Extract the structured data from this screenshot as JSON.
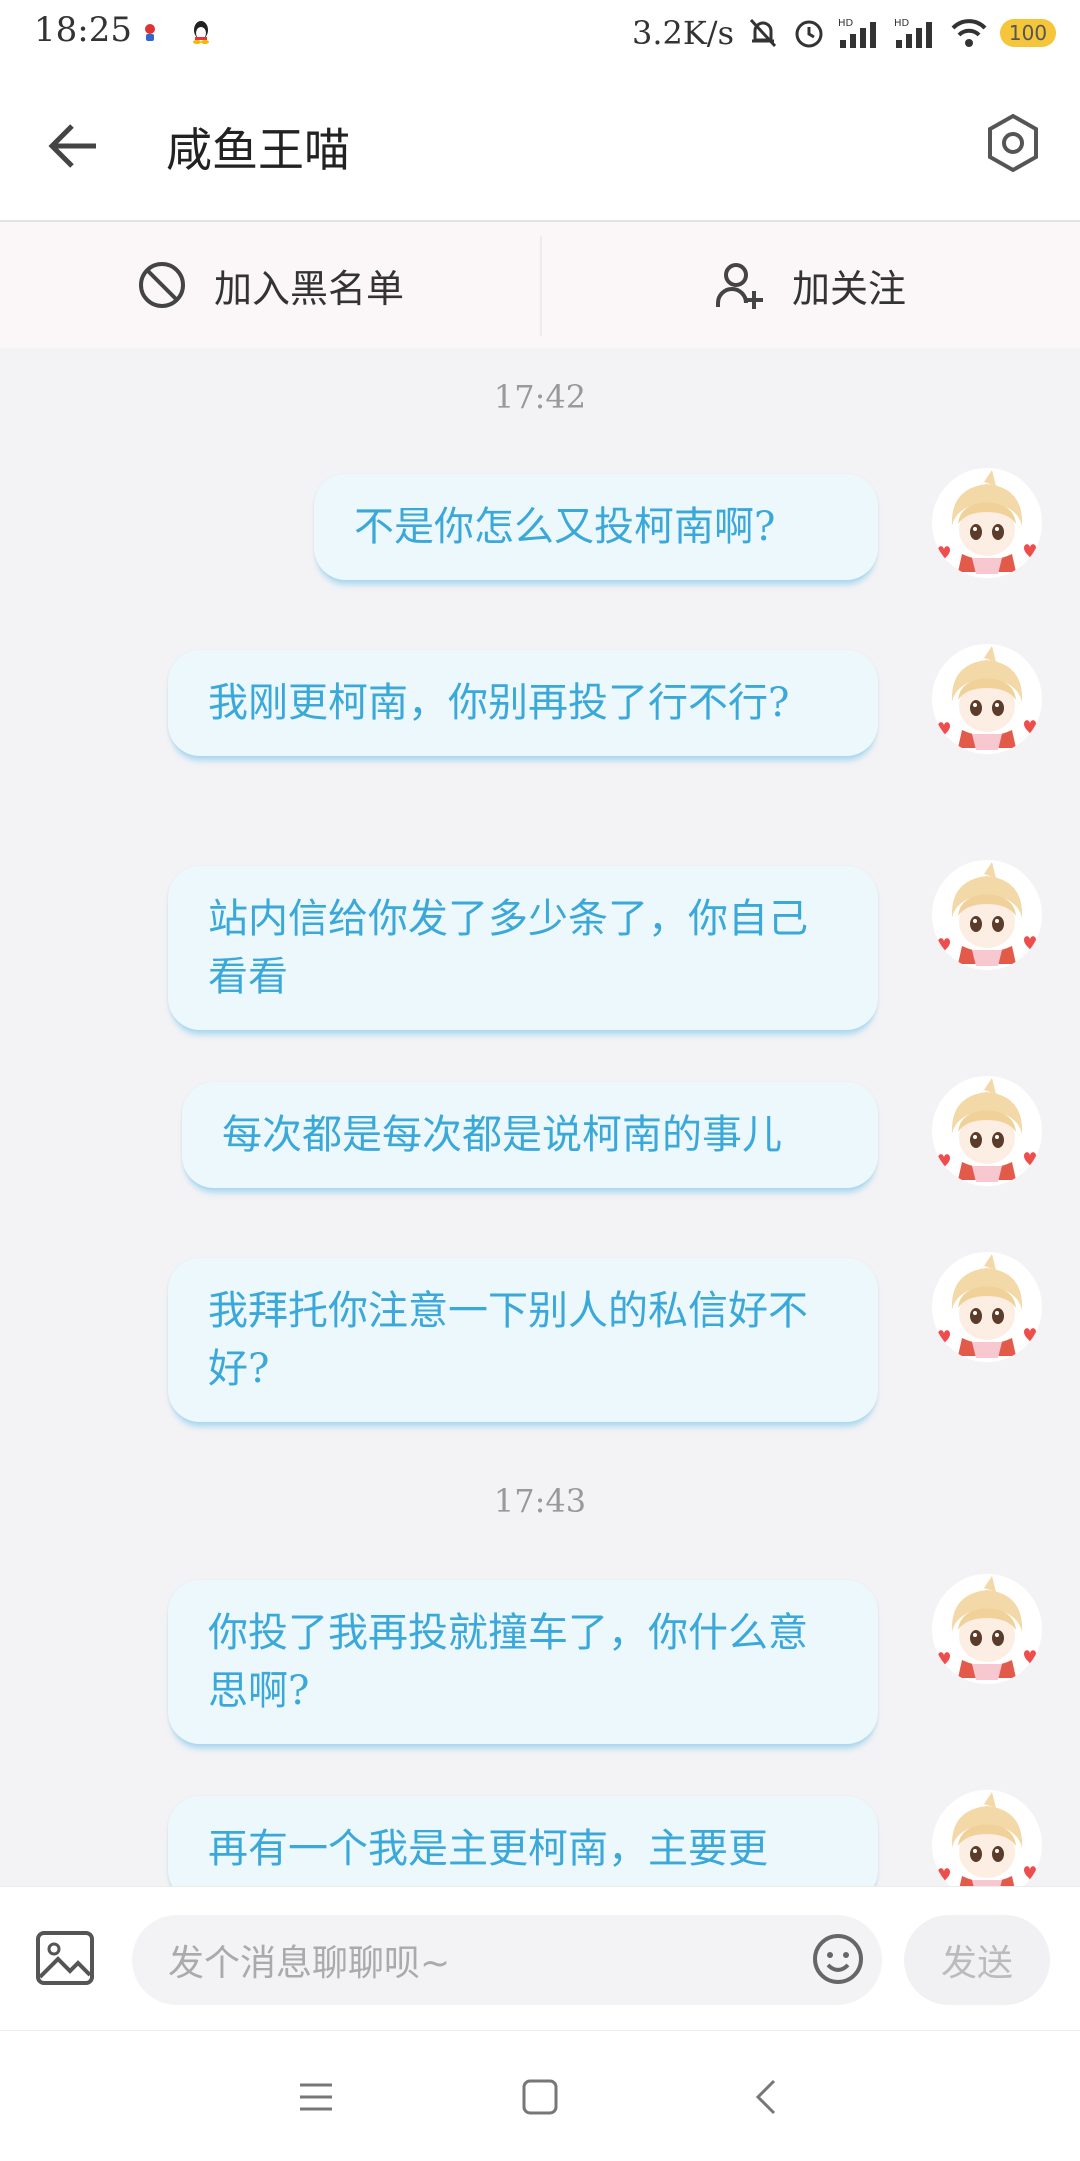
{
  "status_bar": {
    "time": "18:25",
    "network_speed": "3.2K/s",
    "battery": "100",
    "icons": [
      "mute-bell-icon",
      "alarm-icon",
      "signal-hd-icon",
      "signal-hd-icon",
      "wifi-icon"
    ]
  },
  "header": {
    "title": "咸鱼王喵",
    "back_icon": "back-arrow-icon",
    "settings_icon": "hexagon-settings-icon"
  },
  "actions": {
    "blacklist_label": "加入黑名单",
    "follow_label": "加关注"
  },
  "messages": {
    "time1": "17:42",
    "time2": "17:43",
    "m1": "不是你怎么又投柯南啊?",
    "m2": "我刚更柯南，你别再投了行不行?",
    "m3": "站内信给你发了多少条了，你自己看看",
    "m4": "每次都是每次都是说柯南的事儿",
    "m5": "我拜托你注意一下别人的私信好不好?",
    "m6": "你投了我再投就撞车了，你什么意思啊?",
    "m7": "再有一个我是主更柯南，主要更"
  },
  "input": {
    "placeholder": "发个消息聊聊呗~",
    "send_label": "发送"
  },
  "colors": {
    "bubble_bg": "#edf8fd",
    "bubble_text": "#3aa8d8",
    "battery": "#f5c53a"
  }
}
